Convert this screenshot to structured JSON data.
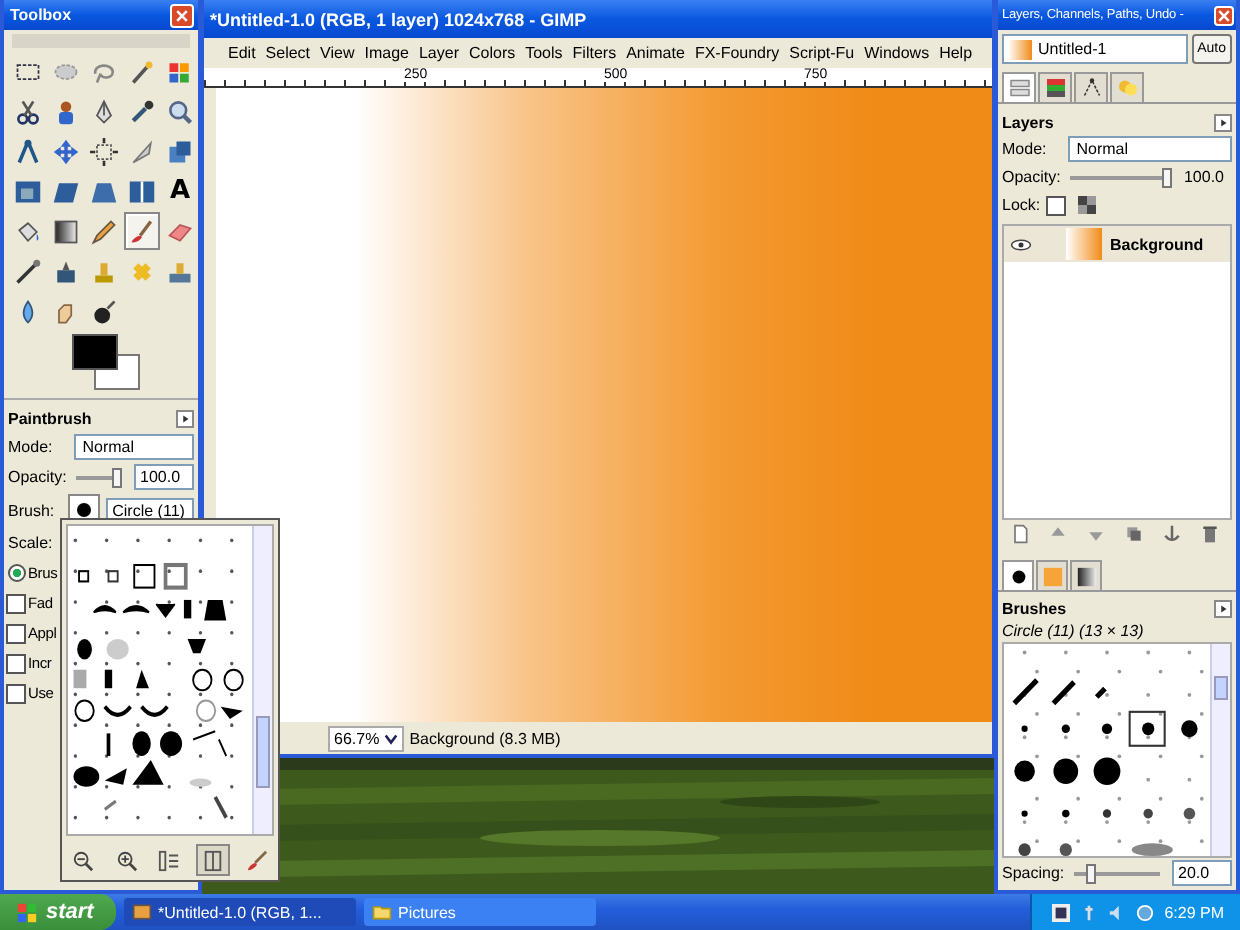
{
  "toolbox": {
    "title": "Toolbox",
    "tools": [
      {
        "selected": false
      },
      {
        "selected": false
      },
      {
        "selected": false
      },
      {
        "selected": false
      },
      {
        "selected": false
      },
      {
        "selected": false
      },
      {
        "selected": false
      },
      {
        "selected": false
      },
      {
        "selected": false
      },
      {
        "selected": false
      },
      {
        "selected": false
      },
      {
        "selected": false
      },
      {
        "selected": false
      },
      {
        "selected": false
      },
      {
        "selected": false
      },
      {
        "selected": false
      },
      {
        "selected": false
      },
      {
        "selected": false
      },
      {
        "selected": false
      },
      {
        "selected": false,
        "glyph": "A"
      },
      {
        "selected": false
      },
      {
        "selected": false
      },
      {
        "selected": false
      },
      {
        "selected": true
      },
      {
        "selected": false
      },
      {
        "selected": false
      },
      {
        "selected": false
      },
      {
        "selected": false
      },
      {
        "selected": false
      },
      {
        "selected": false
      },
      {
        "selected": false
      },
      {
        "selected": false
      },
      {
        "selected": false
      }
    ],
    "options": {
      "title": "Paintbrush",
      "mode_label": "Mode:",
      "mode": "Normal",
      "opacity_label": "Opacity:",
      "opacity": "100.0",
      "opacity_slider": {
        "level": 1
      },
      "brush_label": "Brush:",
      "brush": "Circle (11)",
      "scale_label": "Scale:",
      "radio": {
        "label": "Brus",
        "selected": true
      },
      "checkboxes": [
        {
          "label": "Fad",
          "checked": false
        },
        {
          "label": "Appl",
          "checked": false
        },
        {
          "label": "Incr",
          "checked": false
        },
        {
          "label": "Use",
          "checked": false
        }
      ]
    }
  },
  "image_window": {
    "title": "*Untitled-1.0 (RGB, 1 layer) 1024x768 - GIMP",
    "menu": [
      "Edit",
      "Select",
      "View",
      "Image",
      "Layer",
      "Colors",
      "Tools",
      "Filters",
      "Animate",
      "FX-Foundry",
      "Script-Fu",
      "Windows",
      "Help"
    ],
    "ruler_ticks": [
      "250",
      "500",
      "750"
    ],
    "status": {
      "zoom": "66.7%",
      "info": "Background (8.3 MB)"
    }
  },
  "brush_popup": {
    "buttons": [
      {
        "selected": false
      },
      {
        "selected": false
      },
      {
        "selected": false
      },
      {
        "selected": true
      },
      {
        "selected": false
      }
    ]
  },
  "dock": {
    "title": "Layers, Channels, Paths, Undo -",
    "image": "Untitled-1",
    "auto": "Auto",
    "tabs": [
      {
        "selected": true
      },
      {
        "selected": false
      },
      {
        "selected": false
      },
      {
        "selected": false
      }
    ],
    "layers": {
      "title": "Layers",
      "mode_label": "Mode:",
      "mode": "Normal",
      "opacity_label": "Opacity:",
      "opacity": "100.0",
      "opacity_slider": {
        "level": 1
      },
      "lock_label": "Lock:",
      "lock_pixels": {
        "checked": false
      },
      "items": [
        {
          "name": "Background",
          "visible": true,
          "selected": true
        }
      ]
    },
    "brush_tabs": [
      {
        "selected": true
      },
      {
        "selected": false
      },
      {
        "selected": false
      }
    ],
    "brushes": {
      "title": "Brushes",
      "current": "Circle (11) (13 × 13)",
      "spacing_label": "Spacing:",
      "spacing": "20.0",
      "spacing_slider": {
        "level": 0.15
      }
    }
  },
  "taskbar": {
    "start": "start",
    "tasks": [
      {
        "label": "*Untitled-1.0 (RGB, 1...",
        "selected": true
      },
      {
        "label": "Pictures",
        "selected": false
      }
    ],
    "clock": "6:29 PM"
  }
}
